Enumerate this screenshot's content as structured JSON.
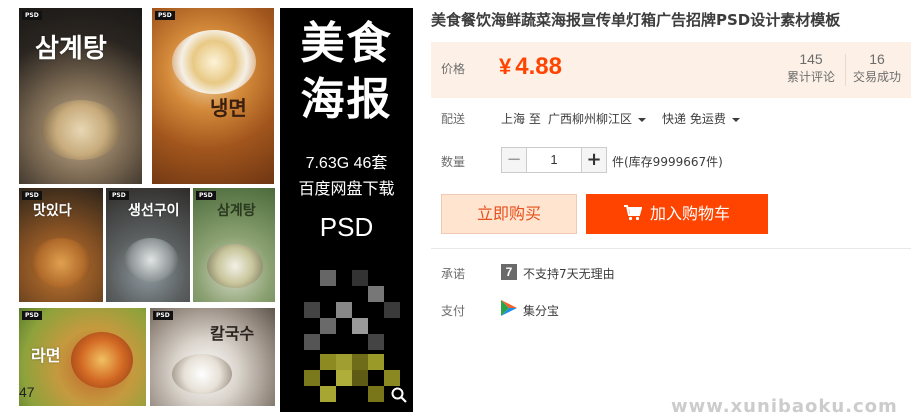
{
  "product": {
    "title": "美食餐饮海鲜蔬菜海报宣传单灯箱广告招牌PSD设计素材模板"
  },
  "gallery": {
    "thumb_tag": "PSD",
    "thumb_titles": [
      "삼계탕",
      "냉면",
      "맛있다",
      "생선구이",
      "삼계탕",
      "라면",
      "칼국수"
    ],
    "count": "47",
    "poster": {
      "line1": "美食",
      "line2": "海报",
      "spec": "7.63G  46套",
      "download": "百度网盘下载",
      "format": "PSD"
    },
    "zoom_icon": "magnifier-icon"
  },
  "price": {
    "label": "价格",
    "currency": "¥",
    "value": "4.88",
    "reviews_count": "145",
    "reviews_label": "累计评论",
    "sales_count": "16",
    "sales_label": "交易成功"
  },
  "shipping": {
    "label": "配送",
    "from": "上海 至",
    "to": "广西柳州柳江区",
    "method": "快递 免运费"
  },
  "quantity": {
    "label": "数量",
    "value": "1",
    "minus": "−",
    "plus": "+",
    "stock": "件(库存9999667件)"
  },
  "actions": {
    "buy_now": "立即购买",
    "add_to_cart": "加入购物车"
  },
  "promise": {
    "label": "承诺",
    "badge": "7",
    "text": "不支持7天无理由"
  },
  "payment": {
    "label": "支付",
    "method": "集分宝"
  },
  "watermark": "www.xunibaoku.com",
  "colors": {
    "accent": "#ff4400",
    "price_bg": "#fdf1e7",
    "buy_now_bg": "#ffe4d0"
  }
}
